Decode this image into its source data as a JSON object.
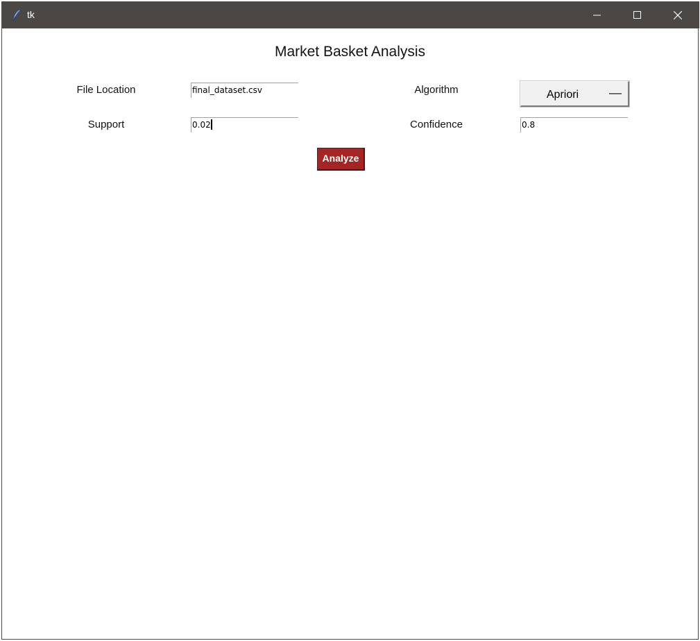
{
  "window": {
    "title": "tk",
    "controls": {
      "minimize": "minimize-icon",
      "maximize": "maximize-icon",
      "close": "close-icon"
    }
  },
  "form": {
    "heading": "Market Basket Analysis",
    "file_location": {
      "label": "File Location",
      "value": "final_dataset.csv"
    },
    "algorithm": {
      "label": "Algorithm",
      "selected": "Apriori"
    },
    "support": {
      "label": "Support",
      "value": "0.02"
    },
    "confidence": {
      "label": "Confidence",
      "value": "0.8"
    },
    "analyze_label": "Analyze"
  },
  "colors": {
    "titlebar": "#4a4744",
    "analyze_button": "#a52525"
  }
}
